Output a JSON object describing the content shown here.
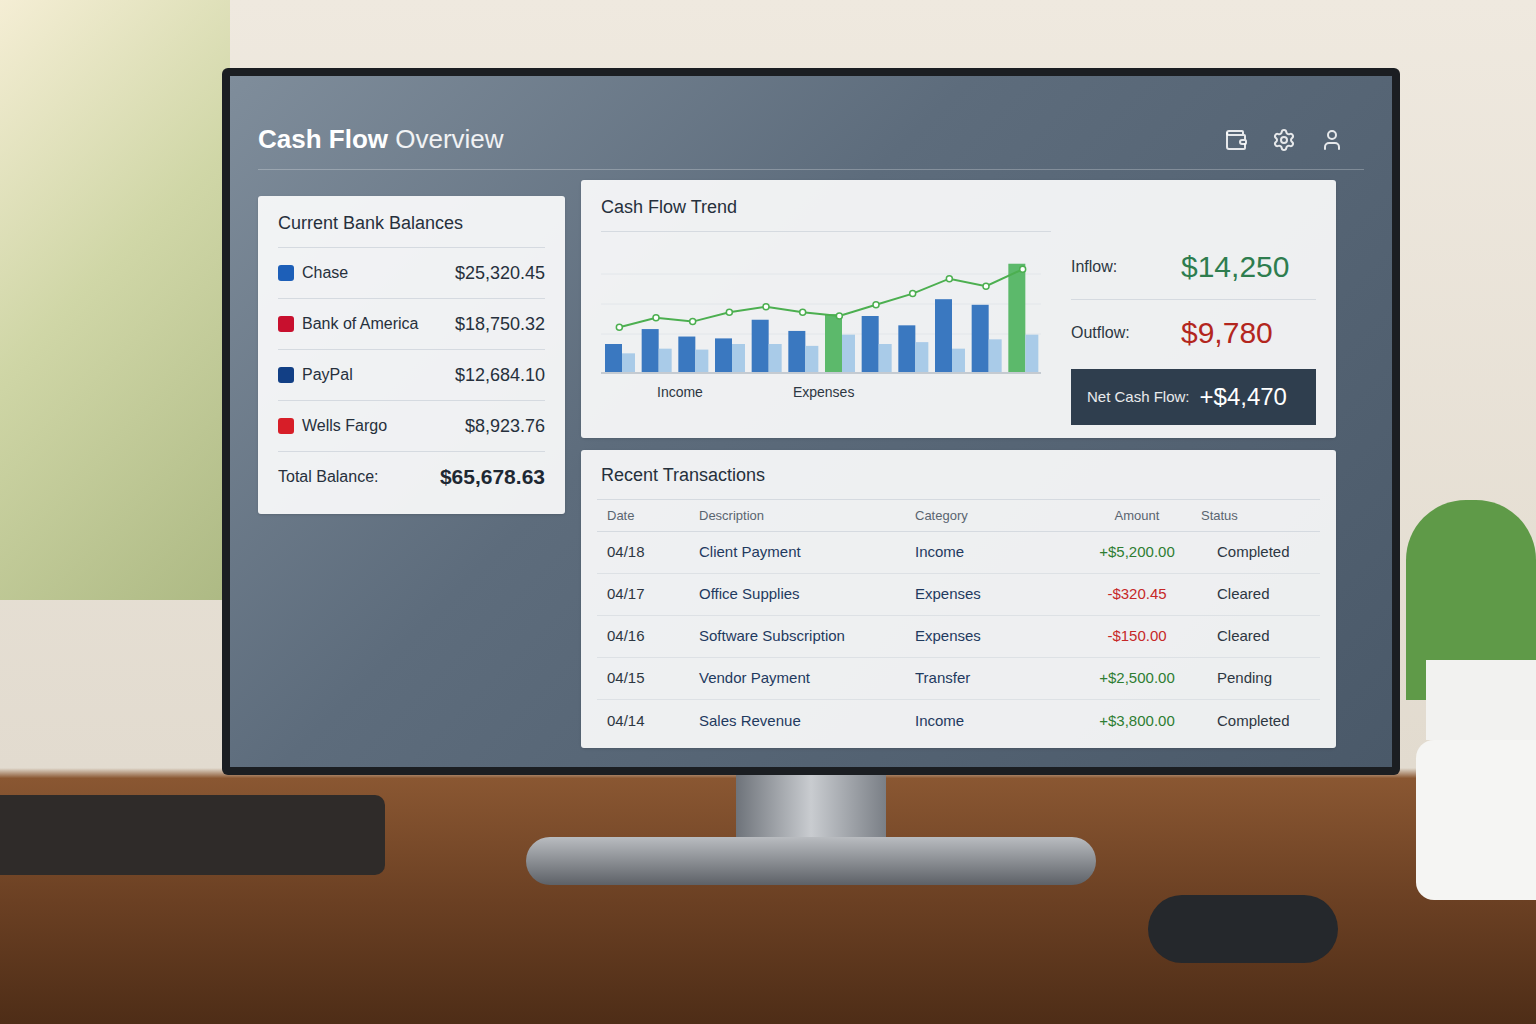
{
  "window": {
    "title_strong": "Cash Flow",
    "title_light": "Overview"
  },
  "balances": {
    "title": "Current Bank Balances",
    "accounts": [
      {
        "name": "Chase",
        "amount": "$25,320.45",
        "color": "#1d5fb8"
      },
      {
        "name": "Bank of America",
        "amount": "$18,750.32",
        "color": "#c8102e"
      },
      {
        "name": "PayPal",
        "amount": "$12,684.10",
        "color": "#123f85"
      },
      {
        "name": "Wells Fargo",
        "amount": "$8,923.76",
        "color": "#d71e28"
      }
    ],
    "total_label": "Total Balance:",
    "total": "$65,678.63"
  },
  "trend": {
    "title": "Cash Flow Trend",
    "legend": [
      "Income",
      "Expenses"
    ],
    "income": [
      30,
      46,
      38,
      36,
      56,
      44,
      62,
      60,
      50,
      78,
      72,
      116
    ],
    "expenses": [
      20,
      25,
      24,
      30,
      30,
      28,
      40,
      30,
      32,
      25,
      35,
      40
    ],
    "highlighted": [
      false,
      false,
      false,
      false,
      false,
      false,
      true,
      false,
      false,
      false,
      false,
      true
    ],
    "line": [
      48,
      58,
      54,
      64,
      70,
      64,
      60,
      72,
      84,
      100,
      92,
      110
    ]
  },
  "summary": {
    "inflow_label": "Inflow:",
    "inflow": "$14,250",
    "outflow_label": "Outflow:",
    "outflow": "$9,780",
    "net_label": "Net Cash Flow:",
    "net": "+$4,470"
  },
  "transactions": {
    "title": "Recent Transactions",
    "columns": [
      "Date",
      "Description",
      "Category",
      "Amount",
      "Status"
    ],
    "rows": [
      {
        "date": "04/18",
        "description": "Client Payment",
        "category": "Income",
        "amount": "+$5,200.00",
        "kind": "credit",
        "status": "Completed"
      },
      {
        "date": "04/17",
        "description": "Office Supplies",
        "category": "Expenses",
        "amount": "-$320.45",
        "kind": "debit",
        "status": "Cleared"
      },
      {
        "date": "04/16",
        "description": "Software Subscription",
        "category": "Expenses",
        "amount": "-$150.00",
        "kind": "debit",
        "status": "Cleared"
      },
      {
        "date": "04/15",
        "description": "Vendor Payment",
        "category": "Transfer",
        "amount": "+$2,500.00",
        "kind": "credit",
        "status": "Pending"
      },
      {
        "date": "04/14",
        "description": "Sales Revenue",
        "category": "Income",
        "amount": "+$3,800.00",
        "kind": "credit",
        "status": "Completed"
      }
    ]
  }
}
